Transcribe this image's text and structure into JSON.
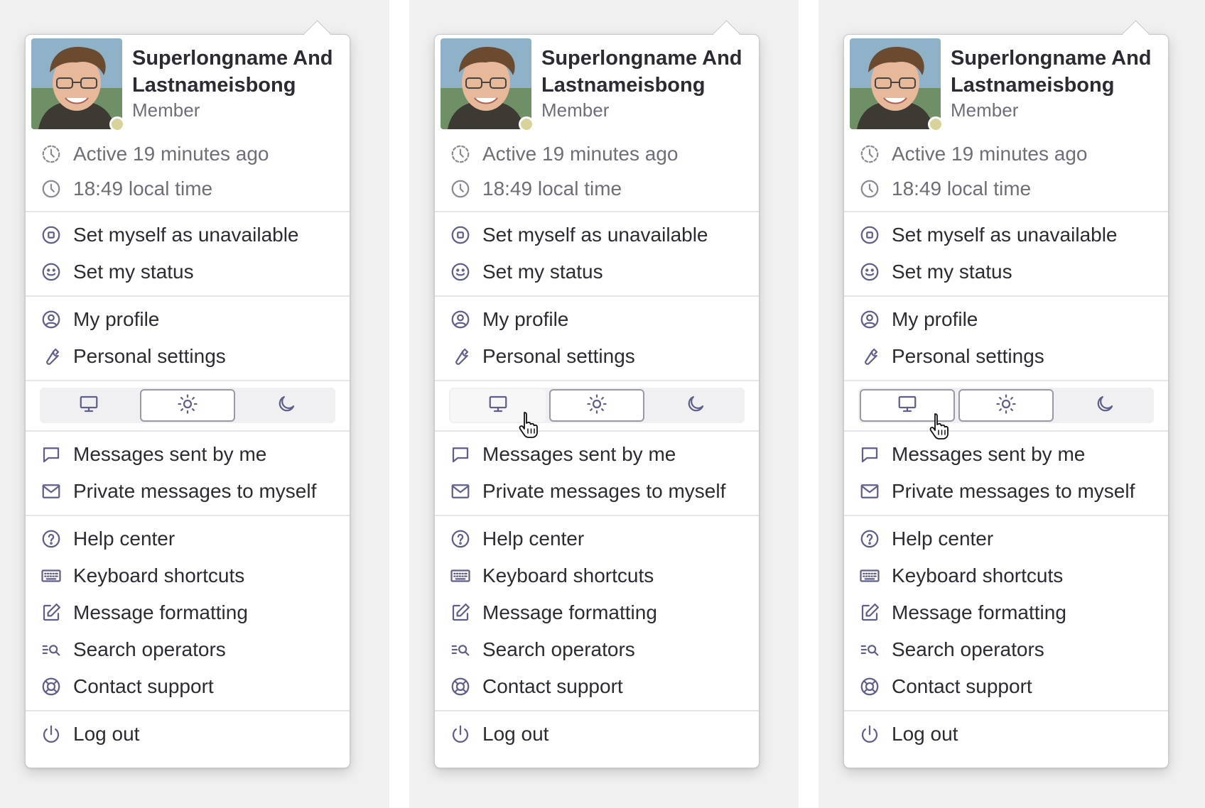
{
  "user": {
    "name": "Superlongname And Lastnameisbong",
    "role": "Member"
  },
  "info": {
    "active": "Active 19 minutes ago",
    "local_time": "18:49 local time"
  },
  "menu": {
    "status": [
      "Set myself as unavailable",
      "Set my status"
    ],
    "profile": [
      "My profile",
      "Personal settings"
    ],
    "messages": [
      "Messages sent by me",
      "Private messages to myself"
    ],
    "help": [
      "Help center",
      "Keyboard shortcuts",
      "Message formatting",
      "Search operators",
      "Contact support"
    ],
    "logout": "Log out"
  },
  "theme_options": [
    "monitor-icon",
    "sun-icon",
    "moon-icon"
  ],
  "panels": [
    {
      "selected_theme": "light",
      "hovered_theme": null
    },
    {
      "selected_theme": "light",
      "hovered_theme": "system"
    },
    {
      "selected_theme": "light",
      "hovered_theme": "system"
    }
  ],
  "colors": {
    "icon": "#5f5f8c",
    "presence": "#d8d39a",
    "text": "#2b2b33",
    "muted": "#6e6e78"
  }
}
